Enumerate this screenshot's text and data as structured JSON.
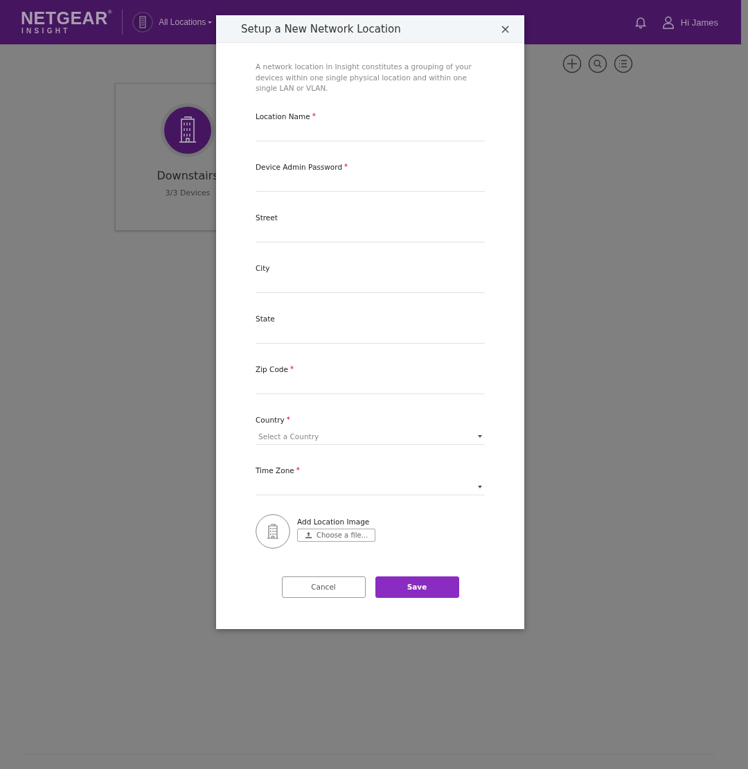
{
  "header": {
    "logo": "NETGEAR",
    "logo_mark": "®",
    "logo_sub": "INSIGHT",
    "location_menu": "All Locations",
    "user_greeting": "Hi James"
  },
  "location_cards": [
    {
      "name": "Downstairs",
      "devices": "3/3 Devices"
    }
  ],
  "dialog": {
    "title": "Setup a New Network Location",
    "close": "×",
    "intro": "A network location in Insight constitutes a grouping of your devices within one single physical location and within one single LAN or VLAN.",
    "fields": [
      {
        "kind": "text",
        "label": "Location Name",
        "required_mark": "*"
      },
      {
        "kind": "text",
        "label": "Device Admin Password",
        "required_mark": "*"
      },
      {
        "kind": "text",
        "label": "Street"
      },
      {
        "kind": "text",
        "label": "City"
      },
      {
        "kind": "text",
        "label": "State"
      },
      {
        "kind": "text",
        "label": "Zip Code",
        "required_mark": "*"
      },
      {
        "kind": "select",
        "label": "Country",
        "required_mark": "*",
        "placeholder": "Select a Country"
      },
      {
        "kind": "select",
        "label": "Time Zone",
        "required_mark": "*"
      }
    ],
    "image_upload": {
      "label": "Add Location Image",
      "button": "Choose a file..."
    },
    "buttons": [
      {
        "kind": "secondary",
        "label": "Cancel"
      },
      {
        "kind": "primary",
        "label": "Save"
      }
    ]
  }
}
